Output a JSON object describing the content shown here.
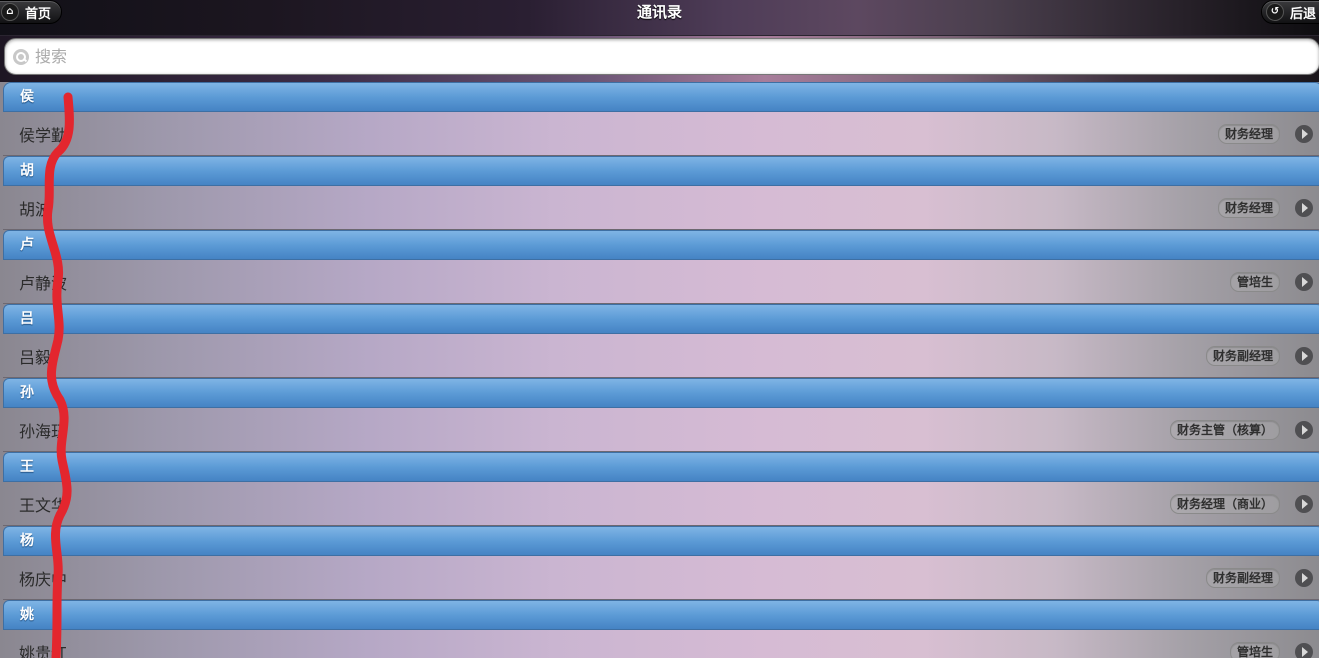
{
  "header": {
    "home_label": "首页",
    "title": "通讯录",
    "refresh_label": "后退"
  },
  "search": {
    "placeholder": "搜索",
    "value": ""
  },
  "groups": [
    {
      "letter": "侯",
      "items": [
        {
          "name": "侯学勤",
          "role": "财务经理"
        }
      ]
    },
    {
      "letter": "胡",
      "items": [
        {
          "name": "胡波",
          "role": "财务经理"
        }
      ]
    },
    {
      "letter": "卢",
      "items": [
        {
          "name": "卢静波",
          "role": "管培生"
        }
      ]
    },
    {
      "letter": "吕",
      "items": [
        {
          "name": "吕毅",
          "role": "财务副经理"
        }
      ]
    },
    {
      "letter": "孙",
      "items": [
        {
          "name": "孙海珏",
          "role": "财务主管（核算）"
        }
      ]
    },
    {
      "letter": "王",
      "items": [
        {
          "name": "王文华",
          "role": "财务经理（商业）"
        }
      ]
    },
    {
      "letter": "杨",
      "items": [
        {
          "name": "杨庆中",
          "role": "财务副经理"
        }
      ]
    },
    {
      "letter": "姚",
      "items": [
        {
          "name": "姚贵红",
          "role": "管培生"
        }
      ]
    }
  ],
  "colors": {
    "divider": "#5c9bd6",
    "annotation": "#e3262e"
  },
  "icons": {
    "home": "home-icon",
    "back": "back-icon",
    "search": "search-icon",
    "row_arrow": "arrow-right-icon"
  }
}
